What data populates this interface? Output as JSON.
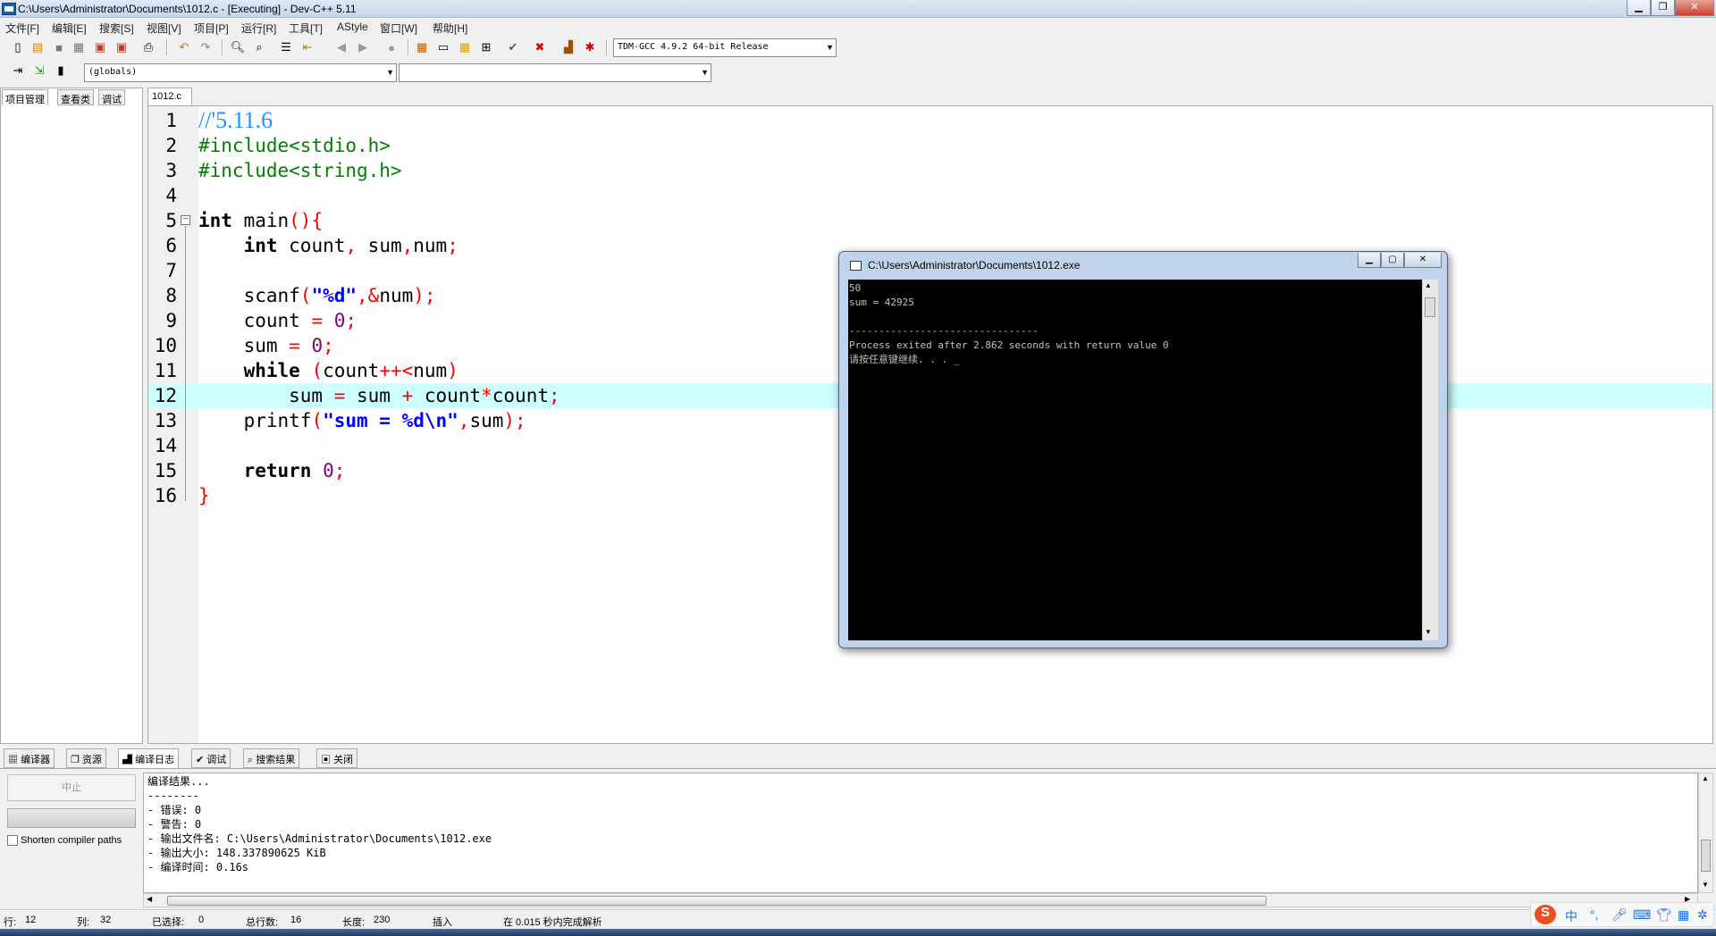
{
  "window": {
    "title": "C:\\Users\\Administrator\\Documents\\1012.c - [Executing] - Dev-C++ 5.11"
  },
  "menu": [
    "文件[F]",
    "编辑[E]",
    "搜索[S]",
    "视图[V]",
    "项目[P]",
    "运行[R]",
    "工具[T]",
    "AStyle",
    "窗口[W]",
    "帮助[H]"
  ],
  "toolbar": {
    "compiler": "TDM-GCC 4.9.2 64-bit Release",
    "scope": "(globals)",
    "member": ""
  },
  "left_tabs": [
    "项目管理",
    "查看类",
    "调试"
  ],
  "editor": {
    "tab": "1012.c",
    "lines": [
      {
        "n": "1",
        "parts": [
          [
            "cm",
            "//'5.11.6"
          ]
        ]
      },
      {
        "n": "2",
        "parts": [
          [
            "pp",
            "#include<stdio.h>"
          ]
        ]
      },
      {
        "n": "3",
        "parts": [
          [
            "pp",
            "#include<string.h>"
          ]
        ]
      },
      {
        "n": "4",
        "parts": []
      },
      {
        "n": "5",
        "parts": [
          [
            "k",
            "int"
          ],
          [
            "",
            " main"
          ],
          [
            "sym",
            "(){"
          ]
        ]
      },
      {
        "n": "6",
        "parts": [
          [
            "",
            "    "
          ],
          [
            "k",
            "int"
          ],
          [
            "",
            " count"
          ],
          [
            "sym",
            ","
          ],
          [
            "",
            " sum"
          ],
          [
            "sym",
            ","
          ],
          [
            "",
            "num"
          ],
          [
            "sym",
            ";"
          ]
        ]
      },
      {
        "n": "7",
        "parts": []
      },
      {
        "n": "8",
        "parts": [
          [
            "",
            "    scanf"
          ],
          [
            "sym",
            "("
          ],
          [
            "s",
            "\"%d\""
          ],
          [
            "sym",
            ",&"
          ],
          [
            "",
            "num"
          ],
          [
            "sym",
            ");"
          ]
        ]
      },
      {
        "n": "9",
        "parts": [
          [
            "",
            "    count "
          ],
          [
            "sym",
            "="
          ],
          [
            "",
            " "
          ],
          [
            "n",
            "0"
          ],
          [
            "sym",
            ";"
          ]
        ]
      },
      {
        "n": "10",
        "parts": [
          [
            "",
            "    sum "
          ],
          [
            "sym",
            "="
          ],
          [
            "",
            " "
          ],
          [
            "n",
            "0"
          ],
          [
            "sym",
            ";"
          ]
        ]
      },
      {
        "n": "11",
        "parts": [
          [
            "",
            "    "
          ],
          [
            "k",
            "while"
          ],
          [
            "",
            " "
          ],
          [
            "sym",
            "("
          ],
          [
            "",
            "count"
          ],
          [
            "sym",
            "++<"
          ],
          [
            "",
            "num"
          ],
          [
            "sym",
            ")"
          ]
        ]
      },
      {
        "n": "12",
        "parts": [
          [
            "",
            "        sum "
          ],
          [
            "sym",
            "="
          ],
          [
            "",
            " sum "
          ],
          [
            "sym",
            "+"
          ],
          [
            "",
            " count"
          ],
          [
            "sym",
            "*"
          ],
          [
            "",
            "count"
          ],
          [
            "sym",
            ";"
          ]
        ]
      },
      {
        "n": "13",
        "parts": [
          [
            "",
            "    printf"
          ],
          [
            "sym",
            "("
          ],
          [
            "s",
            "\"sum = %d\\n\""
          ],
          [
            "sym",
            ","
          ],
          [
            "",
            "sum"
          ],
          [
            "sym",
            ");"
          ]
        ]
      },
      {
        "n": "14",
        "parts": []
      },
      {
        "n": "15",
        "parts": [
          [
            "",
            "    "
          ],
          [
            "k",
            "return"
          ],
          [
            "",
            " "
          ],
          [
            "n",
            "0"
          ],
          [
            "sym",
            ";"
          ]
        ]
      },
      {
        "n": "16",
        "parts": [
          [
            "sym",
            "}"
          ]
        ]
      }
    ]
  },
  "console": {
    "title": "C:\\Users\\Administrator\\Documents\\1012.exe",
    "output": "50\nsum = 42925\n\n--------------------------------\nProcess exited after 2.862 seconds with return value 0\n请按任意键继续. . . _"
  },
  "bottom_tabs": [
    "编译器",
    "资源",
    "编译日志",
    "调试",
    "搜索结果",
    "关闭"
  ],
  "bottom": {
    "abort": "中止",
    "shorten": "Shorten compiler paths",
    "log": "编译结果...\n--------\n- 错误: 0\n- 警告: 0\n- 输出文件名: C:\\Users\\Administrator\\Documents\\1012.exe\n- 输出大小: 148.337890625 KiB\n- 编译时间: 0.16s"
  },
  "status": {
    "row_label": "行:",
    "row": "12",
    "col_label": "列:",
    "col": "32",
    "sel_label": "已选择:",
    "sel": "0",
    "lines_label": "总行数:",
    "lines": "16",
    "len_label": "长度:",
    "len": "230",
    "mode": "插入",
    "parse": "在 0.015 秒内完成解析"
  },
  "ime": {
    "label": "中"
  }
}
